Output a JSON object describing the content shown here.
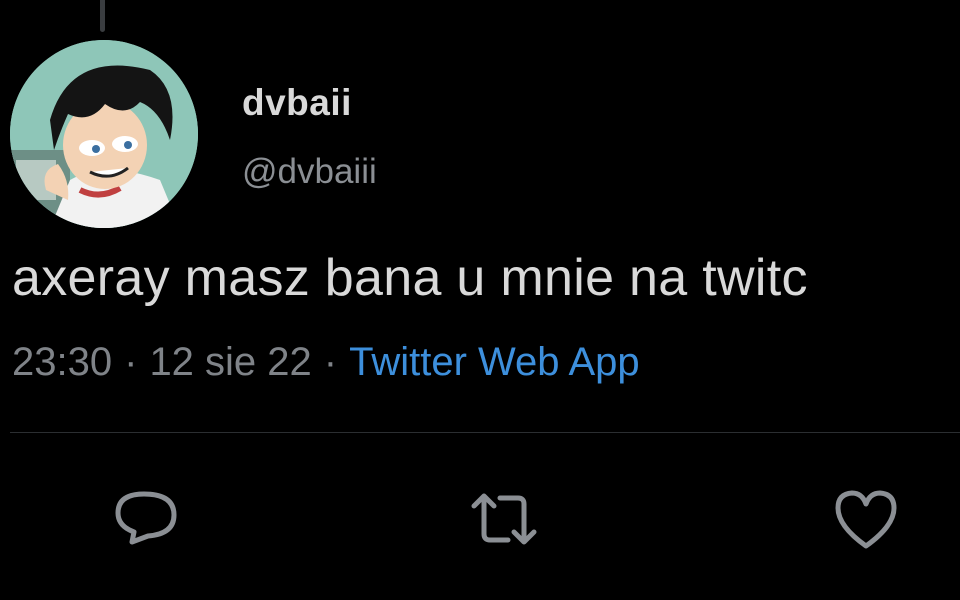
{
  "tweet": {
    "display_name": "dvbaii",
    "handle": "@dvbaiii",
    "text": "axeray masz bana u mnie na twitc",
    "time": "23:30",
    "date": "12 sie 22",
    "separator": "·",
    "source": "Twitter Web App"
  },
  "actions": {
    "reply_icon": "reply-icon",
    "retweet_icon": "retweet-icon",
    "like_icon": "heart-icon"
  },
  "colors": {
    "background": "#000000",
    "source_link": "#3d8fdc",
    "secondary_text": "#7f8388"
  }
}
